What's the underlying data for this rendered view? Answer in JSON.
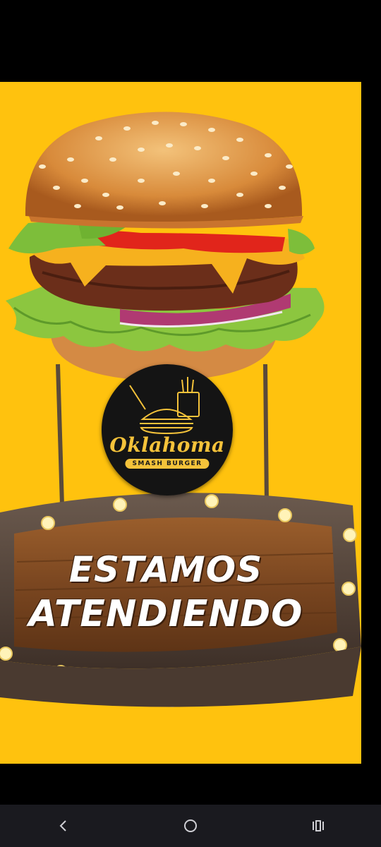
{
  "logo": {
    "brand": "Oklahoma",
    "tagline": "SMASH BURGER"
  },
  "sign": {
    "line1": "ESTAMOS",
    "line2": "ATENDIENDO"
  },
  "colors": {
    "background": "#FFC20E",
    "logo_gold": "#F4C23A",
    "wood": "#7a4a24"
  },
  "navbar": {
    "back_icon": "chevron-left-icon",
    "home_icon": "circle-home-icon",
    "recents_icon": "recents-icon"
  }
}
